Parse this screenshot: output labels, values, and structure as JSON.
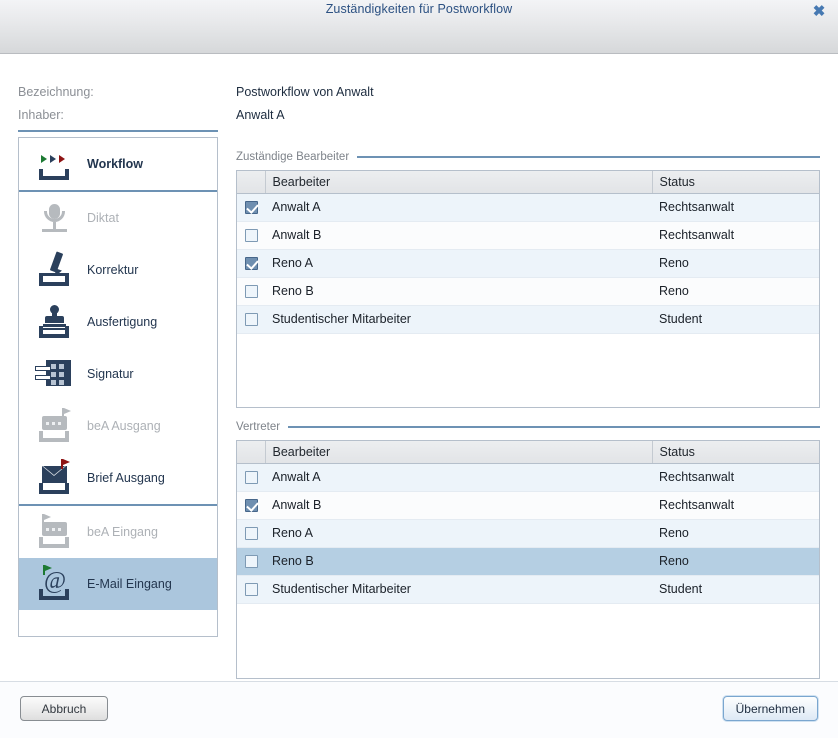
{
  "window": {
    "title": "Zuständigkeiten für Postworkflow",
    "close_icon": "close-icon",
    "close_glyph": "✖"
  },
  "header": {
    "designation_label": "Bezeichnung:",
    "designation_value": "Postworkflow von Anwalt",
    "owner_label": "Inhaber:",
    "owner_value": "Anwalt A"
  },
  "sidebar": {
    "items": [
      {
        "label": "Workflow",
        "icon": "workflow-icon",
        "state": "active",
        "selected": false
      },
      {
        "label": "Diktat",
        "icon": "microphone-icon",
        "state": "disabled",
        "selected": false
      },
      {
        "label": "Korrektur",
        "icon": "pencil-tray-icon",
        "state": "normal",
        "selected": false
      },
      {
        "label": "Ausfertigung",
        "icon": "stamp-icon",
        "state": "normal",
        "selected": false
      },
      {
        "label": "Signatur",
        "icon": "signature-card-icon",
        "state": "normal",
        "selected": false
      },
      {
        "label": "beA Ausgang",
        "icon": "bea-outbox-icon",
        "state": "disabled",
        "selected": false
      },
      {
        "label": "Brief Ausgang",
        "icon": "envelope-out-icon",
        "state": "normal",
        "selected": false
      },
      {
        "label": "beA Eingang",
        "icon": "bea-inbox-icon",
        "state": "disabled",
        "selected": false
      },
      {
        "label": "E-Mail Eingang",
        "icon": "at-inbox-icon",
        "state": "normal",
        "selected": true
      }
    ]
  },
  "responsible": {
    "group_title": "Zuständige Bearbeiter",
    "columns": [
      "",
      "Bearbeiter",
      "Status"
    ],
    "rows": [
      {
        "checked": true,
        "name": "Anwalt A",
        "status": "Rechtsanwalt",
        "selected": false
      },
      {
        "checked": false,
        "name": "Anwalt B",
        "status": "Rechtsanwalt",
        "selected": false
      },
      {
        "checked": true,
        "name": "Reno A",
        "status": "Reno",
        "selected": false
      },
      {
        "checked": false,
        "name": "Reno B",
        "status": "Reno",
        "selected": false
      },
      {
        "checked": false,
        "name": "Studentischer Mitarbeiter",
        "status": "Student",
        "selected": false
      }
    ]
  },
  "deputy": {
    "group_title": "Vertreter",
    "columns": [
      "",
      "Bearbeiter",
      "Status"
    ],
    "rows": [
      {
        "checked": false,
        "name": "Anwalt A",
        "status": "Rechtsanwalt",
        "selected": false
      },
      {
        "checked": true,
        "name": "Anwalt B",
        "status": "Rechtsanwalt",
        "selected": false
      },
      {
        "checked": false,
        "name": "Reno A",
        "status": "Reno",
        "selected": false
      },
      {
        "checked": false,
        "name": "Reno B",
        "status": "Reno",
        "selected": true
      },
      {
        "checked": false,
        "name": "Studentischer Mitarbeiter",
        "status": "Student",
        "selected": false
      }
    ]
  },
  "footer": {
    "cancel_label": "Abbruch",
    "apply_label": "Übernehmen"
  },
  "colors": {
    "accent": "#6d92b4",
    "title_text": "#2c5182",
    "selection": "#abc6dd",
    "row_selection": "#b5cfe3",
    "row_odd": "#edf4fa",
    "row_even": "#fbfcfd",
    "icon_dark": "#2b405c",
    "icon_disabled": "#b6babe"
  }
}
